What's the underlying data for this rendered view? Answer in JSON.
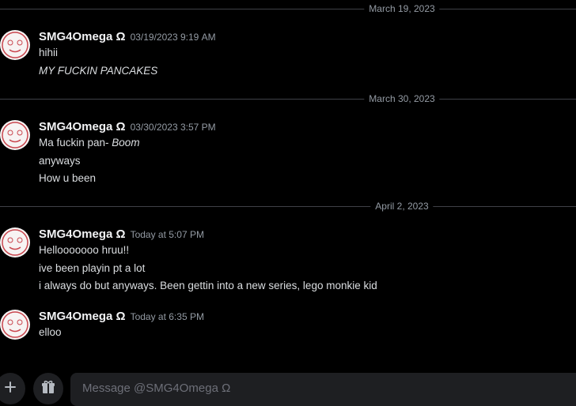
{
  "conversation": {
    "dividers": [
      {
        "date": "March 19, 2023"
      },
      {
        "date": "March 30, 2023"
      },
      {
        "date": "April 2, 2023"
      }
    ],
    "groups": [
      {
        "author": "SMG4Omega Ω",
        "timestamp": "03/19/2023 9:19 AM",
        "messages": [
          {
            "text": "hihii"
          },
          {
            "text": "MY FUCKIN PANCAKES"
          }
        ]
      },
      {
        "author": "SMG4Omega Ω",
        "timestamp": "03/30/2023 3:57 PM",
        "messages": [
          {
            "text": "Ma fuckin pan- ",
            "emphasis": "Boom"
          },
          {
            "text": "anyways"
          },
          {
            "text": "How u been"
          }
        ]
      },
      {
        "author": "SMG4Omega Ω",
        "timestamp": "Today at 5:07 PM",
        "messages": [
          {
            "text": "Hellooooooo hruu!!"
          },
          {
            "text": "ive been playin pt a lot"
          },
          {
            "text": "i always do but anyways. Been gettin into a new series, lego monkie kid"
          }
        ]
      },
      {
        "author": "SMG4Omega Ω",
        "timestamp": "Today at 6:35 PM",
        "messages": [
          {
            "text": "elloo"
          }
        ]
      }
    ]
  },
  "composer": {
    "placeholder": "Message @SMG4Omega Ω",
    "add_icon": "plus-icon",
    "gift_icon": "gift-icon"
  },
  "colors": {
    "background": "#000000",
    "divider": "#3f4147",
    "muted_text": "#949ba4",
    "author": "#f2f3f5"
  }
}
